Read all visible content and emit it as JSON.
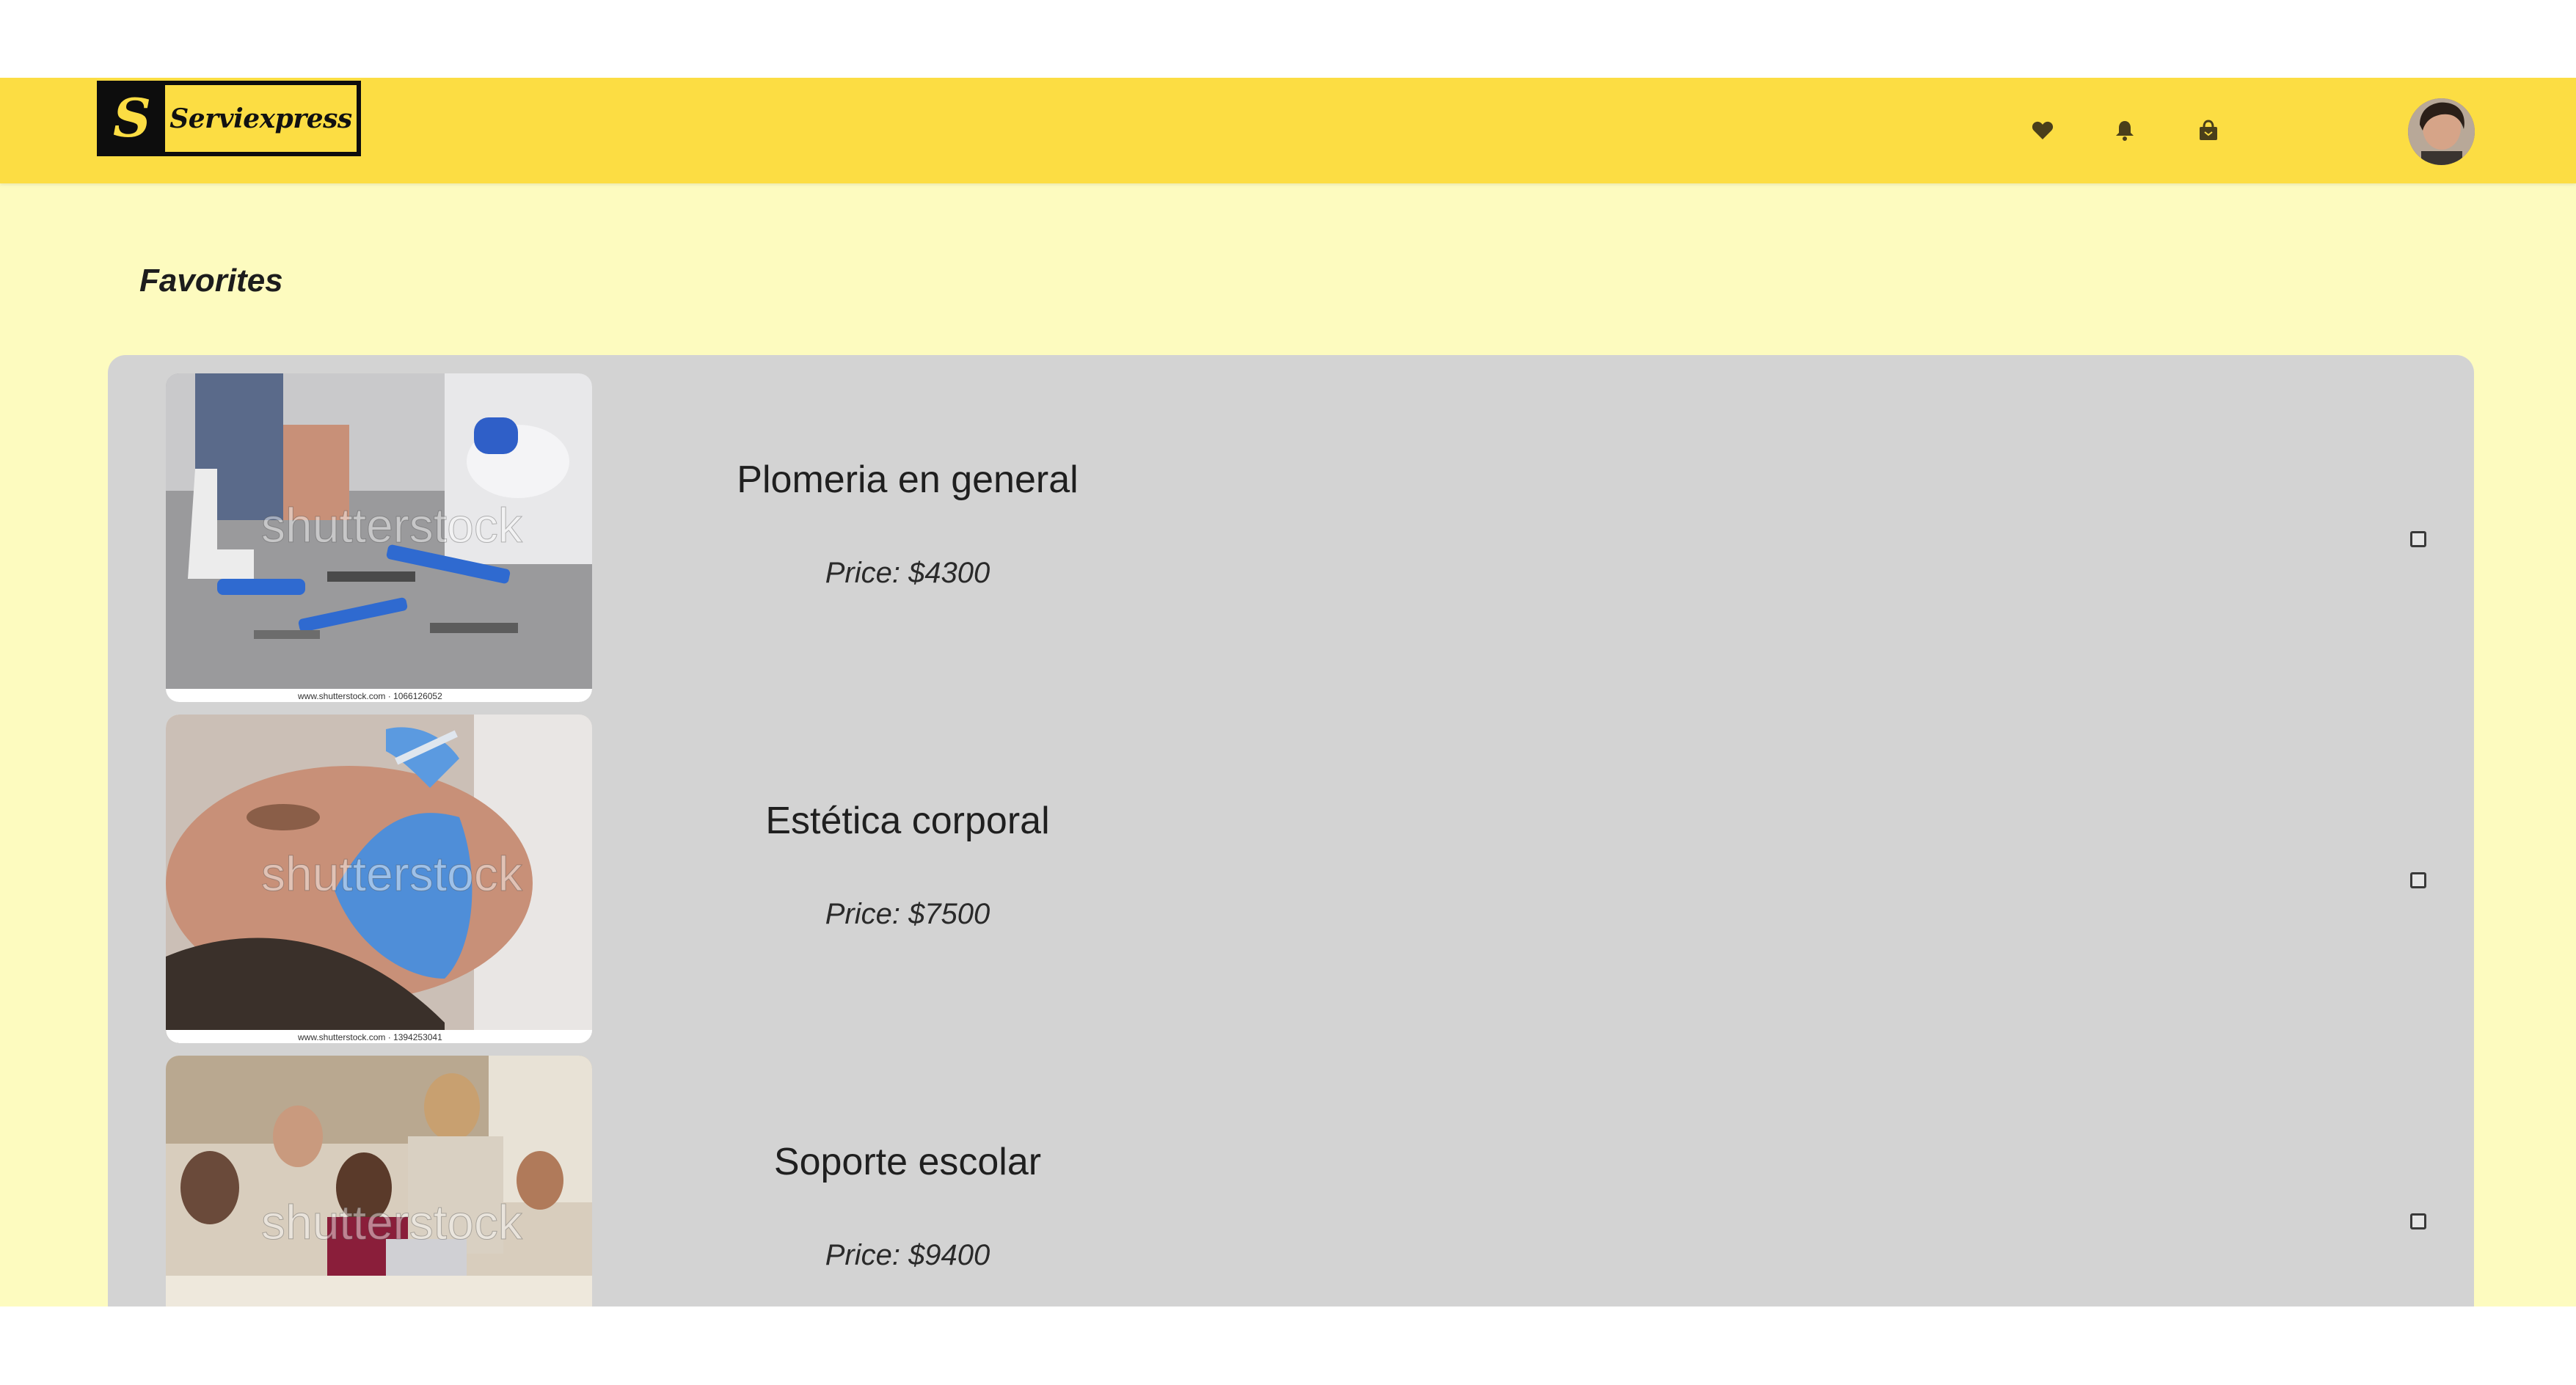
{
  "brand": {
    "logo_letter": "S",
    "name": "Serviexpress"
  },
  "navbar": {
    "icons": [
      "heart-icon",
      "bell-icon",
      "bag-icon"
    ]
  },
  "page": {
    "title": "Favorites"
  },
  "favorites": [
    {
      "title": "Plomeria en general",
      "price": "Price: $4300",
      "image_watermark": "shutterstock",
      "image_footer": "www.shutterstock.com · 1066126052"
    },
    {
      "title": "Estética corporal",
      "price": "Price: $7500",
      "image_watermark": "shutterstock",
      "image_footer": "www.shutterstock.com · 1394253041"
    },
    {
      "title": "Soporte escolar",
      "price": "Price: $9400",
      "image_watermark": "shutterstock",
      "image_footer": ""
    }
  ],
  "colors": {
    "navbar": "#fcdd43",
    "background": "#fdfbbf",
    "panel": "#d3d3d3"
  }
}
